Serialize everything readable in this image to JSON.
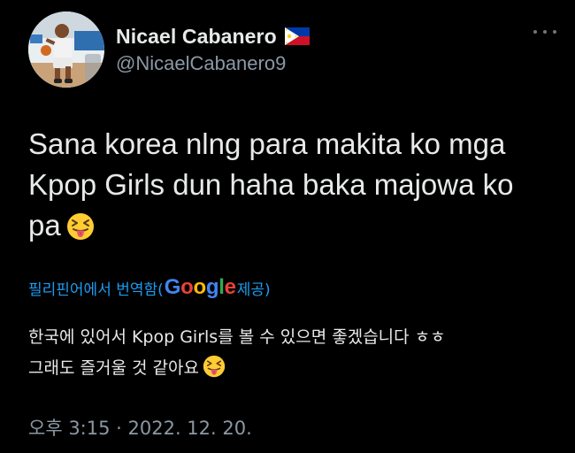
{
  "user": {
    "display_name": "Nicael Cabanero",
    "handle": "@NicaelCabanero9",
    "flag_icon": "philippines-flag-icon"
  },
  "tweet": {
    "text_line1": "Sana korea nlng para makita ko mga",
    "text_line2": "Kpop Girls dun haha baka majowa ko",
    "text_line3": "pa",
    "emoji": "squinting-face-with-tongue"
  },
  "translation": {
    "label_prefix": "필리핀어에서 번역함(",
    "google_word": "Google",
    "label_suffix": " 제공)",
    "line1": "한국에 있어서 Kpop Girls를 볼 수 있으면 좋겠습니다 ㅎㅎ",
    "line2": "그래도 즐거울 것 같아요"
  },
  "meta": {
    "timestamp": "오후 3:15 · 2022. 12. 20."
  },
  "colors": {
    "background": "#000000",
    "primary_text": "#e7e9ea",
    "secondary_text": "#8b98a5",
    "link": "#1d9bf0"
  }
}
